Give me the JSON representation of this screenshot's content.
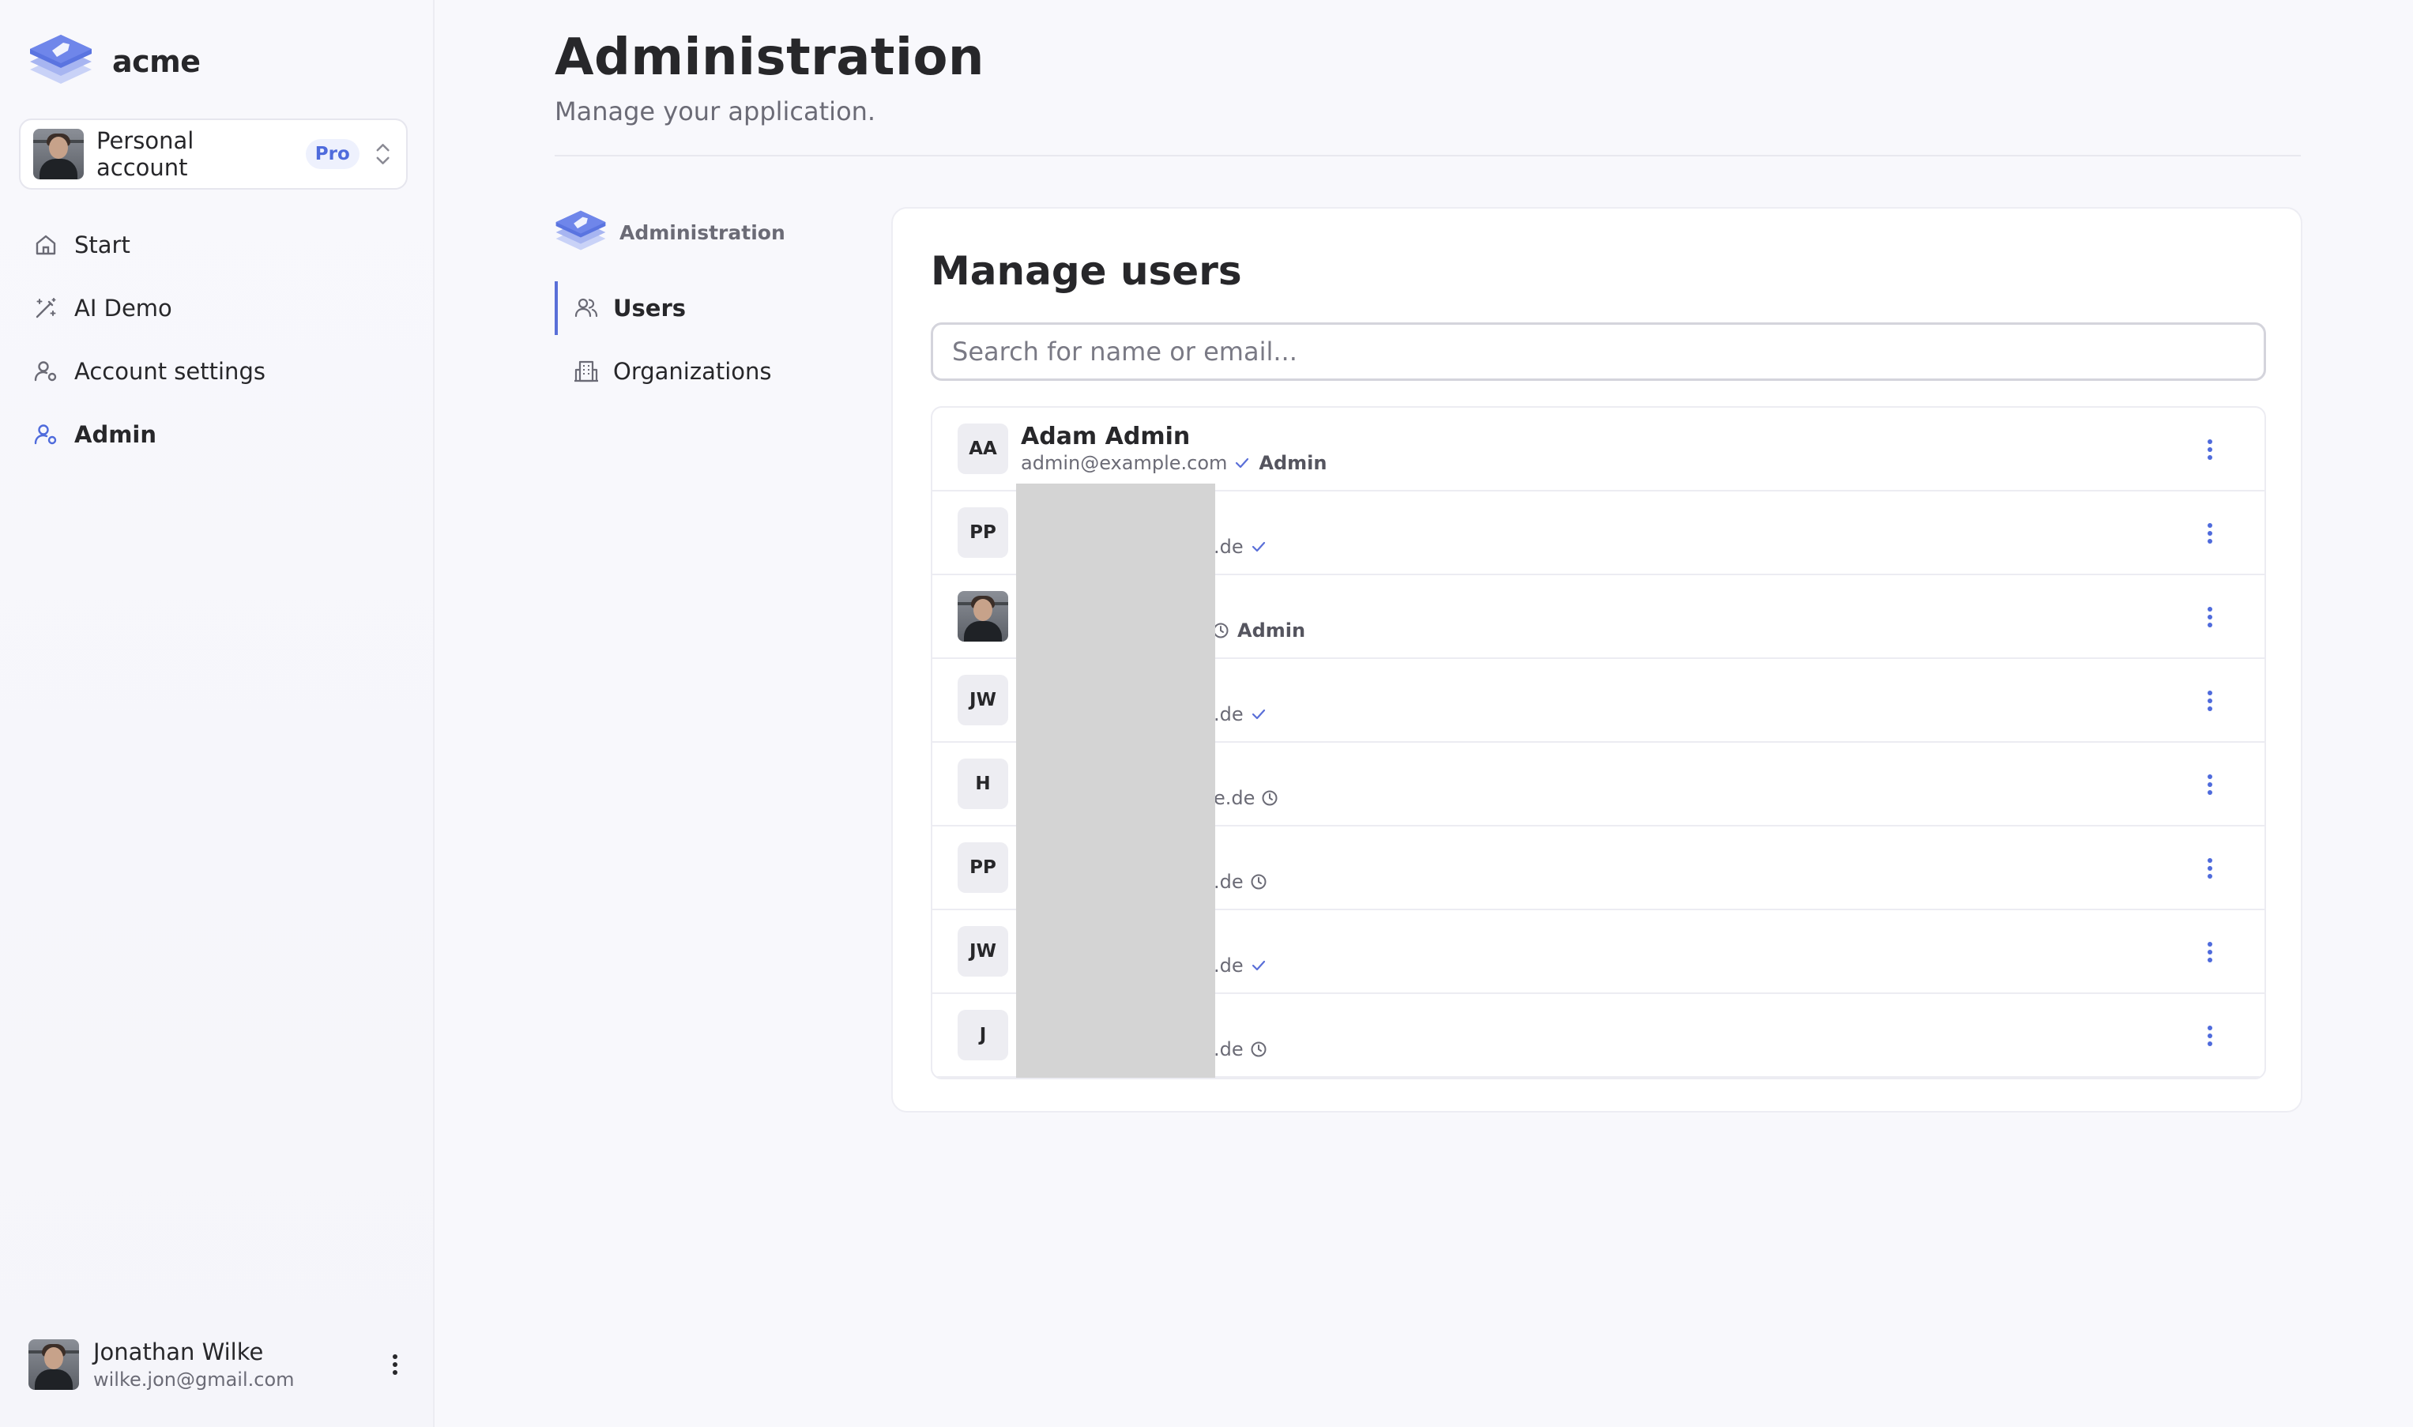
{
  "brand": {
    "name": "acme"
  },
  "account": {
    "label": "Personal account",
    "badge": "Pro"
  },
  "nav": {
    "items": [
      {
        "label": "Start",
        "icon": "home-icon"
      },
      {
        "label": "AI Demo",
        "icon": "magic-wand-icon"
      },
      {
        "label": "Account settings",
        "icon": "user-cog-icon"
      },
      {
        "label": "Admin",
        "icon": "user-shield-icon",
        "active": true
      }
    ]
  },
  "current_user": {
    "name": "Jonathan Wilke",
    "email": "wilke.jon@gmail.com"
  },
  "page": {
    "title": "Administration",
    "subtitle": "Manage your application."
  },
  "subnav": {
    "header": "Administration",
    "items": [
      {
        "label": "Users",
        "icon": "users-icon",
        "active": true
      },
      {
        "label": "Organizations",
        "icon": "building-icon"
      }
    ]
  },
  "users_card": {
    "title": "Manage users",
    "search_placeholder": "Search for name or email...",
    "rows": [
      {
        "initials": "AA",
        "name": "Adam Admin",
        "email": "admin@example.com",
        "status": "verified",
        "role": "Admin"
      },
      {
        "initials": "PP",
        "email_suffix": ".de",
        "status": "verified"
      },
      {
        "avatar": "photo",
        "status": "pending",
        "role": "Admin"
      },
      {
        "initials": "JW",
        "email_suffix": ".de",
        "status": "verified"
      },
      {
        "initials": "H",
        "email_suffix": "e.de",
        "status": "pending"
      },
      {
        "initials": "PP",
        "email_suffix": ".de",
        "status": "pending"
      },
      {
        "initials": "JW",
        "email_suffix": ".de",
        "status": "verified"
      },
      {
        "initials": "J",
        "email_suffix": ".de",
        "status": "pending"
      }
    ]
  },
  "colors": {
    "accent": "#4f6bdc",
    "check": "#5a6fd8",
    "text": "#27272a",
    "muted": "#6b6b76"
  }
}
